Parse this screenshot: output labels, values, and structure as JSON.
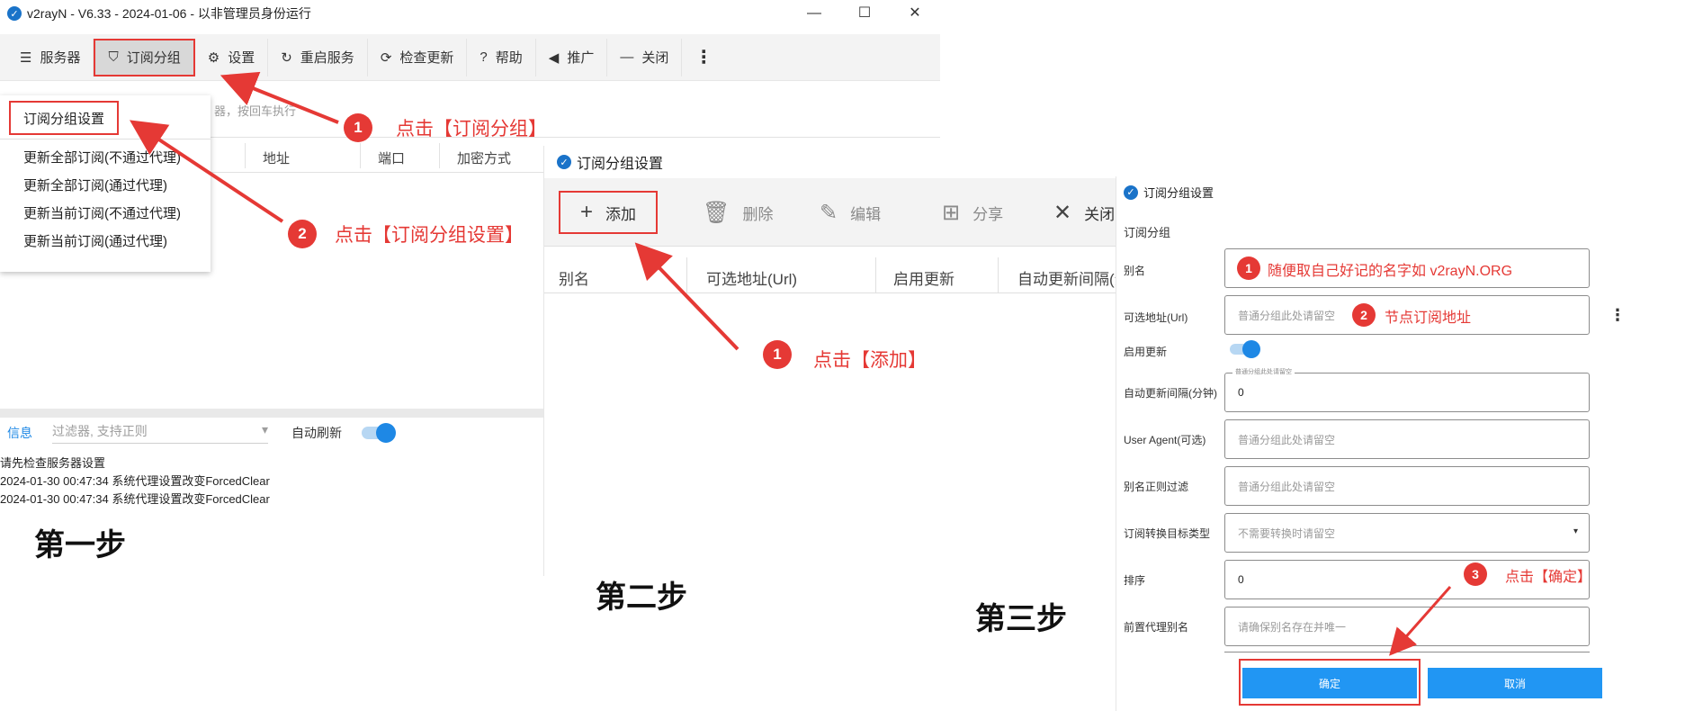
{
  "panel1": {
    "title": "v2rayN - V6.33 - 2024-01-06 - 以非管理员身份运行",
    "app_icon": "v2rayn-logo-icon",
    "window_controls": {
      "minimize": "—",
      "maximize": "☐",
      "close": "✕"
    },
    "toolbar": [
      {
        "id": "servers",
        "label": "服务器",
        "icon": "server-icon",
        "glyph": "☰"
      },
      {
        "id": "sub-group",
        "label": "订阅分组",
        "icon": "bookmark-icon",
        "glyph": "⛉"
      },
      {
        "id": "settings",
        "label": "设置",
        "icon": "gear-icon",
        "glyph": "⚙"
      },
      {
        "id": "restart",
        "label": "重启服务",
        "icon": "refresh-icon",
        "glyph": "↻"
      },
      {
        "id": "check-update",
        "label": "检查更新",
        "icon": "update-icon",
        "glyph": "⟳"
      },
      {
        "id": "help",
        "label": "帮助",
        "icon": "help-icon",
        "glyph": "?"
      },
      {
        "id": "promote",
        "label": "推广",
        "icon": "speaker-icon",
        "glyph": "◀"
      },
      {
        "id": "close",
        "label": "关闭",
        "icon": "minus-icon",
        "glyph": "—"
      }
    ],
    "more_glyph": "⋮",
    "dropdown": {
      "first": "订阅分组设置",
      "items": [
        "更新全部订阅(不通过代理)",
        "更新全部订阅(通过代理)",
        "更新当前订阅(不通过代理)",
        "更新当前订阅(通过代理)"
      ]
    },
    "search_hint": "器，按回车执行",
    "columns": [
      "地址",
      "端口",
      "加密方式"
    ],
    "log": {
      "tab": "信息",
      "filter_placeholder": "过滤器, 支持正则",
      "filter_caret": "▾",
      "auto_refresh": "自动刷新",
      "auto_refresh_on": true,
      "lines": [
        "请先检查服务器设置",
        "2024-01-30 00:47:34 系统代理设置改变ForcedClear",
        "2024-01-30 00:47:34 系统代理设置改变ForcedClear"
      ]
    },
    "step_label": "第一步",
    "annotations": [
      {
        "num": "1",
        "text": "点击【订阅分组】"
      },
      {
        "num": "2",
        "text": "点击【订阅分组设置】"
      }
    ]
  },
  "panel2": {
    "title": "订阅分组设置",
    "toolbar": [
      {
        "id": "add",
        "label": "添加",
        "icon": "plus-icon",
        "glyph": "+"
      },
      {
        "id": "delete",
        "label": "删除",
        "icon": "trash-icon",
        "glyph": "🗑"
      },
      {
        "id": "edit",
        "label": "编辑",
        "icon": "pencil-icon",
        "glyph": "✎"
      },
      {
        "id": "share",
        "label": "分享",
        "icon": "qr-icon",
        "glyph": "⊞"
      },
      {
        "id": "close",
        "label": "关闭",
        "icon": "close-icon",
        "glyph": "✕"
      }
    ],
    "columns": [
      "别名",
      "可选地址(Url)",
      "启用更新",
      "自动更新间隔(分"
    ],
    "step_label": "第二步",
    "annotation": {
      "num": "1",
      "text": "点击【添加】"
    }
  },
  "panel3": {
    "title": "订阅分组设置",
    "section": "订阅分组",
    "fields": [
      {
        "label": "别名",
        "value": "",
        "placeholder": ""
      },
      {
        "label": "可选地址(Url)",
        "value": "",
        "placeholder": "普通分组此处请留空"
      },
      {
        "label": "启用更新",
        "toggle": true
      },
      {
        "label": "自动更新间隔(分钟)",
        "value": "0",
        "legend": "普通分组此处请留空"
      },
      {
        "label": "User Agent(可选)",
        "value": "",
        "placeholder": "普通分组此处请留空"
      },
      {
        "label": "别名正则过滤",
        "value": "",
        "placeholder": "普通分组此处请留空"
      },
      {
        "label": "订阅转换目标类型",
        "value": "",
        "placeholder": "不需要转换时请留空",
        "caret": "▾"
      },
      {
        "label": "排序",
        "value": "0"
      },
      {
        "label": "前置代理别名",
        "value": "",
        "placeholder": "请确保别名存在并唯一"
      }
    ],
    "more_glyph": "⋮",
    "ok_label": "确定",
    "cancel_label": "取消",
    "step_label": "第三步",
    "annotations": [
      {
        "num": "1",
        "text": "随便取自己好记的名字如 v2rayN.ORG"
      },
      {
        "num": "2",
        "text": "节点订阅地址"
      },
      {
        "num": "3",
        "text": "点击【确定】"
      }
    ]
  },
  "colors": {
    "accent_red": "#e53935",
    "accent_blue": "#1e88e5",
    "button_blue": "#2196f3"
  }
}
